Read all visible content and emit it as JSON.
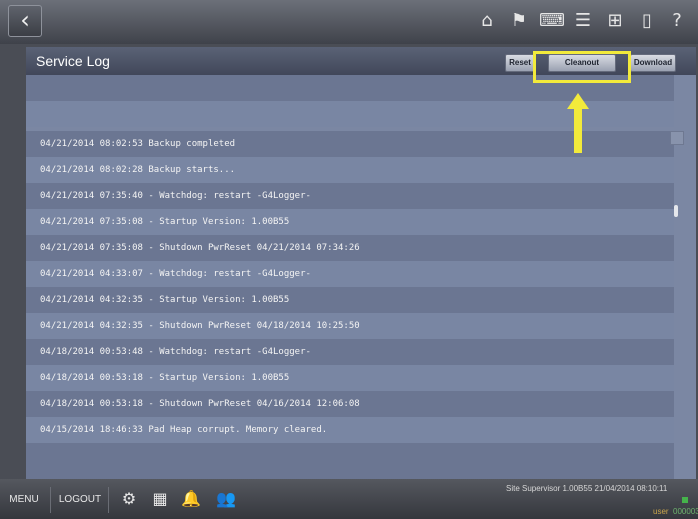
{
  "topbar": {
    "back_glyph": "‹",
    "icons": [
      {
        "name": "home-icon",
        "glyph": "⌂"
      },
      {
        "name": "flag-icon",
        "glyph": "⚑"
      },
      {
        "name": "keyboard-icon",
        "glyph": "⌨"
      },
      {
        "name": "list-icon",
        "glyph": "☰"
      },
      {
        "name": "network-icon",
        "glyph": "⊞"
      },
      {
        "name": "book-icon",
        "glyph": "▯"
      },
      {
        "name": "help-icon",
        "glyph": "?"
      }
    ]
  },
  "panel": {
    "title": "Service Log",
    "reset_label": "Reset",
    "cleanout_label": "Cleanout",
    "download_label": "Download"
  },
  "log": {
    "entries": [
      "",
      "",
      "04/21/2014 08:02:53 Backup completed",
      "04/21/2014 08:02:28 Backup starts...",
      "04/21/2014 07:35:40 - Watchdog: restart -G4Logger-",
      "04/21/2014 07:35:08 - Startup Version: 1.00B55",
      "04/21/2014 07:35:08 - Shutdown PwrReset 04/21/2014 07:34:26",
      "04/21/2014 04:33:07 - Watchdog: restart -G4Logger-",
      "04/21/2014 04:32:35 - Startup Version: 1.00B55",
      "04/21/2014 04:32:35 - Shutdown PwrReset 04/18/2014 10:25:50",
      "04/18/2014 00:53:48 - Watchdog: restart -G4Logger-",
      "04/18/2014 00:53:18 - Startup Version: 1.00B55",
      "04/18/2014 00:53:18 - Shutdown PwrReset 04/16/2014 12:06:08",
      "04/15/2014 18:46:33 Pad Heap corrupt. Memory cleared."
    ]
  },
  "bottombar": {
    "menu_label": "MENU",
    "logout_label": "LOGOUT",
    "icons": [
      {
        "name": "settings-icon",
        "glyph": "⚙"
      },
      {
        "name": "calendar-icon",
        "glyph": "▦"
      },
      {
        "name": "alarm-bell-icon",
        "glyph": "🔔"
      },
      {
        "name": "users-icon",
        "glyph": "👥"
      }
    ],
    "status": "Site Supervisor 1.00B55 21/04/2014 08:10:11",
    "user_label": "user",
    "code": "000003"
  },
  "colors": {
    "highlight": "#f2ea3b",
    "panel": "#7b87a3",
    "row_dark": "#6b7692",
    "row_light": "#7986a3"
  }
}
